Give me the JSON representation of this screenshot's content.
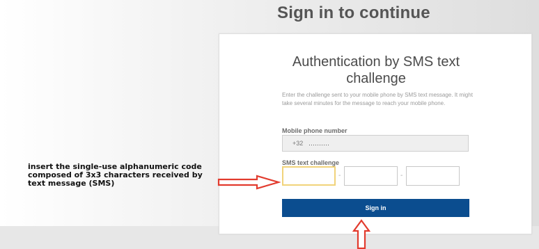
{
  "page": {
    "title": "Sign in to continue"
  },
  "card": {
    "title": "Authentication by SMS text challenge",
    "instructions": "Enter the challenge sent to your mobile phone by SMS text message. It might take several minutes for the message to reach your mobile phone.",
    "mobile_label": "Mobile phone number",
    "mobile_prefix": "+32",
    "mobile_masked": "..........",
    "sms_label": "SMS text challenge",
    "sms_separator": "-",
    "signin_label": "Sign in"
  },
  "annotation": {
    "text": "insert the single-use alphanumeric code composed of 3x3 characters received by text message (SMS)"
  },
  "colors": {
    "button": "#0b4d8f",
    "arrow": "#e23b2e",
    "focus_border": "#f1d37a"
  },
  "icons": {
    "pointer_right": "arrow-right-icon",
    "pointer_up": "arrow-up-icon"
  }
}
